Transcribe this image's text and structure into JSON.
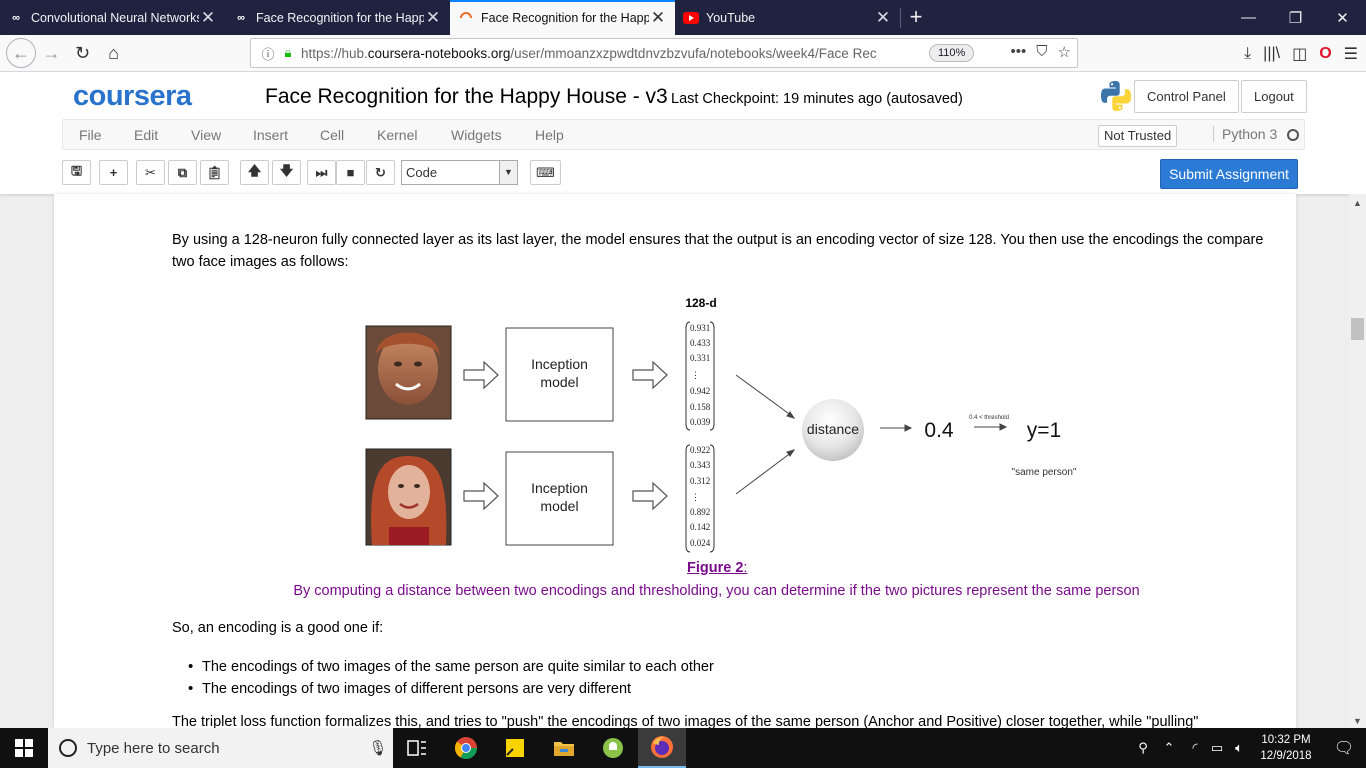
{
  "browser": {
    "tabs": [
      {
        "title": "Convolutional Neural Networks",
        "icon": "coursera-infinity-icon",
        "active": false
      },
      {
        "title": "Face Recognition for the Happy House",
        "icon": "coursera-infinity-icon",
        "active": false
      },
      {
        "title": "Face Recognition for the Happy House",
        "icon": "loading-spinner-icon",
        "active": true
      },
      {
        "title": "YouTube",
        "icon": "youtube-icon",
        "active": false
      }
    ],
    "url_prefix": "https://hub.",
    "url_domain": "coursera-notebooks.org",
    "url_path": "/user/mmoanzxzpwdtdnvzbzvufa/notebooks/week4/Face Rec",
    "zoom": "110%"
  },
  "jupyter": {
    "logo_text": "coursera",
    "notebook_title": "Face Recognition for the Happy House - v3",
    "checkpoint": "Last Checkpoint: 19 minutes ago (autosaved)",
    "control_panel": "Control Panel",
    "logout": "Logout",
    "menu": [
      "File",
      "Edit",
      "View",
      "Insert",
      "Cell",
      "Kernel",
      "Widgets",
      "Help"
    ],
    "trusted": "Not Trusted",
    "kernel": "Python 3",
    "cell_type": "Code",
    "submit": "Submit Assignment",
    "colors": {
      "submit_bg": "#2b7bd6",
      "logo": "#2a73cc",
      "caption": "#7a0c8c"
    }
  },
  "content": {
    "paragraph1": "By using a 128-neuron fully connected layer as its last layer, the model ensures that the output is an encoding vector of size 128. You then use the encodings the compare two face images as follows:",
    "figure": {
      "dim_label": "128-d",
      "model_label_line1": "Inception",
      "model_label_line2": "model",
      "encoding1": [
        "0.931",
        "0.433",
        "0.331",
        "⋮",
        "0.942",
        "0.158",
        "0.039"
      ],
      "encoding2": [
        "0.922",
        "0.343",
        "0.312",
        "⋮",
        "0.892",
        "0.142",
        "0.024"
      ],
      "distance_label": "distance",
      "distance_value": "0.4",
      "threshold_label": "0.4 < threshold",
      "result": "y=1",
      "result_note": "\"same person\""
    },
    "figure_caption": "Figure 2",
    "figure_caption_colon": ":",
    "figure_description": "By computing a distance between two encodings and thresholding, you can determine if the two pictures represent the same person",
    "paragraph2": "So, an encoding is a good one if:",
    "bullets": [
      "The encodings of two images of the same person are quite similar to each other",
      "The encodings of two images of different persons are very different"
    ],
    "paragraph3": "The triplet loss function formalizes this, and tries to \"push\" the encodings of two images of the same person (Anchor and Positive) closer together, while \"pulling\""
  },
  "taskbar": {
    "search_placeholder": "Type here to search",
    "time": "10:32 PM",
    "date": "12/9/2018"
  }
}
